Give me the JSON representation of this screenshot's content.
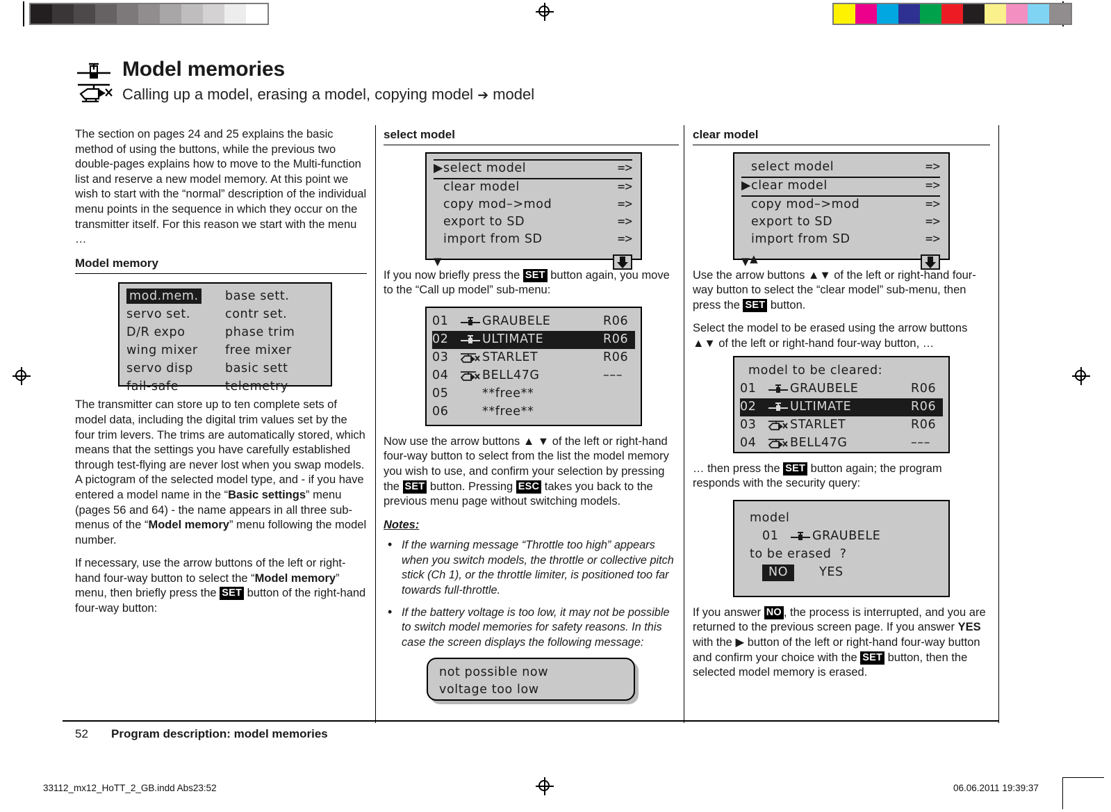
{
  "calibration": {
    "gray_steps": [
      "#231f20",
      "#3a3537",
      "#4d4849",
      "#666162",
      "#7d797a",
      "#918d8e",
      "#a9a6a7",
      "#bfbdbe",
      "#d4d2d3",
      "#eeeded",
      "#ffffff"
    ],
    "color_steps": [
      "#fff200",
      "#ec008c",
      "#00a7e1",
      "#2e3192",
      "#00a14b",
      "#ed1c24",
      "#231f20",
      "#fbf18c",
      "#f490c1",
      "#7fd4f4",
      "#918d8e"
    ]
  },
  "header": {
    "title": "Model memories",
    "subtitle_pre": "Calling up a model, erasing a model, copying model ",
    "subtitle_arrow": "➔",
    "subtitle_post": " model",
    "icon_plane": "airplane-pictogram",
    "icon_heli": "helicopter-pictogram"
  },
  "col1": {
    "intro": "The section on pages 24 and 25 explains the basic method of using the buttons, while the previous two double-pages explains how to move to the Multi-function list and reserve a new model memory. At this point we wish to start with the “normal” description of the individual menu points in the sequence in which they occur on the transmitter itself. For this reason we start with the menu …",
    "heading": "Model memory",
    "lcd_menu": {
      "left": [
        "mod.mem.",
        "servo set.",
        "D/R expo",
        "wing mixer",
        "servo disp",
        "fail-safe"
      ],
      "right": [
        "base sett.",
        "contr set.",
        "phase trim",
        "free mixer",
        "basic sett",
        "telemetry"
      ],
      "selected": "mod.mem."
    },
    "p2_a": "The transmitter can store up to ten complete sets of model data, including the digital trim values set by the four trim levers. The trims are automatically stored, which means that the settings you have carefully established through test-flying are never lost when you swap models. A pictogram of the selected model type, and - if you have entered a model name in the “",
    "p2_b": "Basic settings",
    "p2_c": "” menu (pages 56 and 64) - the name appears in all three sub-menus of the “",
    "p2_d": "Model memory",
    "p2_e": "” menu following the model number.",
    "p3_a": "If necessary, use the arrow buttons of the left or right-hand four-way button to select the “",
    "p3_b": "Model memory",
    "p3_c": "” menu, then briefly press the ",
    "p3_key": "SET",
    "p3_d": " button of the right-hand four-way button:"
  },
  "col2": {
    "heading": "select model",
    "lcd_menu": {
      "rows": [
        {
          "label": "select model",
          "value": "=>",
          "cursor": true,
          "selected": true
        },
        {
          "label": "clear model",
          "value": "=>",
          "cursor": false,
          "selected": false
        },
        {
          "label": "copy mod–>mod",
          "value": "=>",
          "cursor": false,
          "selected": false
        },
        {
          "label": "export to SD",
          "value": "=>",
          "cursor": false,
          "selected": false
        },
        {
          "label": "import from SD",
          "value": "=>",
          "cursor": false,
          "selected": false
        }
      ],
      "pager_down": "▼",
      "pager_up": "",
      "sd_icon": "sd-card-icon"
    },
    "p1_a": "If you now briefly press the ",
    "p1_key": "SET",
    "p1_b": " button again, you move to the “Call up model” sub-menu:",
    "lcd_list": {
      "rows": [
        {
          "num": "01",
          "pic": "plane",
          "name": "GRAUBELE",
          "rx": "R06",
          "selected": false
        },
        {
          "num": "02",
          "pic": "plane",
          "name": "ULTIMATE",
          "rx": "R06",
          "selected": true
        },
        {
          "num": "03",
          "pic": "heli",
          "name": "STARLET",
          "rx": "R06",
          "selected": false
        },
        {
          "num": "04",
          "pic": "heli",
          "name": "BELL47G",
          "rx": "–––",
          "selected": false
        },
        {
          "num": "05",
          "pic": "",
          "name": "**free**",
          "rx": "",
          "selected": false
        },
        {
          "num": "06",
          "pic": "",
          "name": "**free**",
          "rx": "",
          "selected": false
        }
      ]
    },
    "p2_a": "Now use the arrow buttons ",
    "p2_arrows": "▲ ▼",
    "p2_b": " of the left or right-hand four-way button to select from the list the model memory you wish to use, and confirm your selection by pressing the ",
    "p2_key1": "SET",
    "p2_c": " button. Pressing ",
    "p2_key2": "ESC",
    "p2_d": " takes you back to the previous menu page without switching models.",
    "notes_title": "Notes:",
    "notes": [
      "If the warning message “Throttle too high” appears when you switch models, the throttle or collective pitch stick (Ch 1), or the throttle limiter, is positioned too far towards full-throttle.",
      "If the battery voltage is too low, it may not be possible to switch model memories for safety reasons. In this case the screen displays the following message:"
    ],
    "lcd_warning": {
      "line1": "not possible now",
      "line2": "voltage too low"
    }
  },
  "col3": {
    "heading": "clear model",
    "lcd_menu": {
      "rows": [
        {
          "label": "select model",
          "value": "=>",
          "cursor": false,
          "selected": false
        },
        {
          "label": "clear model",
          "value": "=>",
          "cursor": true,
          "selected": true
        },
        {
          "label": "copy mod–>mod",
          "value": "=>",
          "cursor": false,
          "selected": false
        },
        {
          "label": "export to SD",
          "value": "=>",
          "cursor": false,
          "selected": false
        },
        {
          "label": "import from SD",
          "value": "=>",
          "cursor": false,
          "selected": false
        }
      ],
      "pager_down": "▼",
      "pager_up": "▲",
      "sd_icon": "sd-card-icon"
    },
    "p1_a": "Use the arrow buttons ",
    "p1_arrows": "▲▼",
    "p1_b": " of the left or right-hand four-way button to select the “clear model” sub-menu, then press the ",
    "p1_key": "SET",
    "p1_c": " button.",
    "p2_a": "Select the model to be erased using the arrow buttons ",
    "p2_arrows": "▲▼",
    "p2_b": " of the left or right-hand four-way button, …",
    "lcd_clear": {
      "title": "model to be cleared:",
      "rows": [
        {
          "num": "01",
          "pic": "plane",
          "name": "GRAUBELE",
          "rx": "R06",
          "selected": false
        },
        {
          "num": "02",
          "pic": "plane",
          "name": "ULTIMATE",
          "rx": "R06",
          "selected": true
        },
        {
          "num": "03",
          "pic": "heli",
          "name": "STARLET",
          "rx": "R06",
          "selected": false
        },
        {
          "num": "04",
          "pic": "heli",
          "name": "BELL47G",
          "rx": "–––",
          "selected": false
        }
      ]
    },
    "p3_a": "… then press the ",
    "p3_key": "SET",
    "p3_b": " button again; the program responds with the security query:",
    "lcd_query": {
      "line1": "model",
      "num": "01",
      "pic": "plane",
      "name": "GRAUBELE",
      "line3": "to be erased  ?",
      "no": "NO",
      "yes": "YES",
      "selected": "NO"
    },
    "p4_a": "If you answer ",
    "p4_key1": "NO",
    "p4_b": ", the process is interrupted, and you are returned to the previous screen page. If you answer ",
    "p4_yes": "YES",
    "p4_c": " with the ",
    "p4_arrow": "▶",
    "p4_d": " button of the left or right-hand four-way button and confirm your choice with the ",
    "p4_key2": "SET",
    "p4_e": " button, then the selected model memory is erased."
  },
  "footer": {
    "page_number": "52",
    "running_title": "Program description: model memories",
    "file_left": "33112_mx12_HoTT_2_GB.indd   Abs23:52",
    "file_right": "06.06.2011   19:39:37"
  }
}
